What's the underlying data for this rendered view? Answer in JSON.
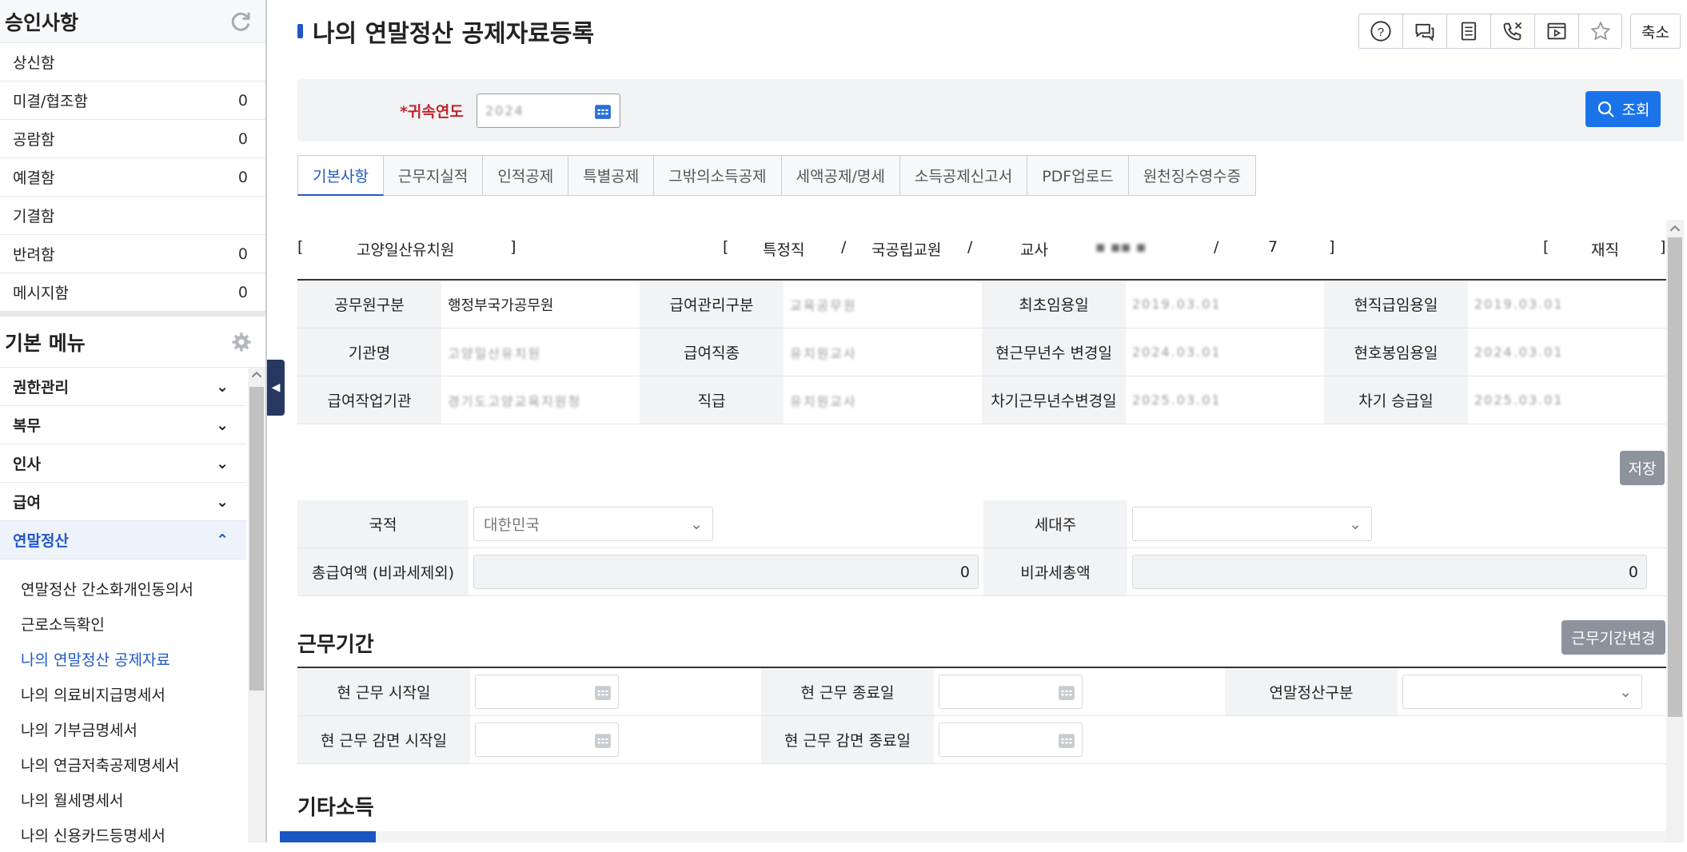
{
  "sidebar": {
    "approval_title": "승인사항",
    "approval_items": [
      {
        "label": "상신함",
        "count": ""
      },
      {
        "label": "미결/협조함",
        "count": "0"
      },
      {
        "label": "공람함",
        "count": "0"
      },
      {
        "label": "예결함",
        "count": "0"
      },
      {
        "label": "기결함",
        "count": ""
      },
      {
        "label": "반려함",
        "count": "0"
      },
      {
        "label": "메시지함",
        "count": "0"
      }
    ],
    "menu_title": "기본 메뉴",
    "menu_items": [
      {
        "label": "권한관리"
      },
      {
        "label": "복무"
      },
      {
        "label": "인사"
      },
      {
        "label": "급여"
      },
      {
        "label": "연말정산"
      }
    ],
    "sub_items": [
      {
        "label": "연말정산 간소화개인동의서"
      },
      {
        "label": "근로소득확인"
      },
      {
        "label": "나의 연말정산 공제자료"
      },
      {
        "label": "나의 의료비지급명세서"
      },
      {
        "label": "나의 기부금명세서"
      },
      {
        "label": "나의 연금저축공제명세서"
      },
      {
        "label": "나의 월세명세서"
      },
      {
        "label": "나의 신용카드등명세서"
      }
    ]
  },
  "header": {
    "title": "나의 연말정산 공제자료등록",
    "toolbar_icons": [
      "help-icon",
      "chat-icon",
      "document-icon",
      "phone-icon",
      "video-icon",
      "star-icon"
    ],
    "shrink_label": "축소"
  },
  "search": {
    "year_label": "*귀속연도",
    "year_value": "2024",
    "button_label": "조회"
  },
  "tabs": [
    "기본사항",
    "근무지실적",
    "인적공제",
    "특별공제",
    "그밖의소득공제",
    "세액공제/명세",
    "소득공제신고서",
    "PDF업로드",
    "원천징수영수증"
  ],
  "info": {
    "school": "고양일산유치원",
    "job_type": "특정직",
    "category": "국공립교원",
    "position": "교사",
    "grade": "7",
    "status": "재직"
  },
  "detail": {
    "row1": [
      {
        "h": "공무원구분",
        "v": "행정부국가공무원"
      },
      {
        "h": "급여관리구분",
        "v": "교육공무원"
      },
      {
        "h": "최초임용일",
        "v": "2019.03.01"
      },
      {
        "h": "현직급임용일",
        "v": "2019.03.01"
      }
    ],
    "row2": [
      {
        "h": "기관명",
        "v": "고양일산유치원"
      },
      {
        "h": "급여직종",
        "v": "유치원교사"
      },
      {
        "h": "현근무년수 변경일",
        "v": "2024.03.01"
      },
      {
        "h": "현호봉임용일",
        "v": "2024.03.01"
      }
    ],
    "row3": [
      {
        "h": "급여작업기관",
        "v": "경기도고양교육지원청"
      },
      {
        "h": "직급",
        "v": "유치원교사"
      },
      {
        "h": "차기근무년수변경일",
        "v": "2025.03.01"
      },
      {
        "h": "차기 승급일",
        "v": "2025.03.01"
      }
    ]
  },
  "save_label": "저장",
  "form2": {
    "nationality_label": "국적",
    "nationality_value": "대한민국",
    "householder_label": "세대주",
    "householder_value": "",
    "total_pay_label": "총급여액 (비과세제외)",
    "total_pay_value": "0",
    "nontax_label": "비과세총액",
    "nontax_value": "0"
  },
  "period": {
    "section_title": "근무기간",
    "change_button": "근무기간변경",
    "start_label": "현 근무 시작일",
    "end_label": "현 근무 종료일",
    "settle_label": "연말정산구분",
    "reduce_start_label": "현 근무 감면 시작일",
    "reduce_end_label": "현 근무 감면 종료일"
  },
  "other_income_title": "기타소득",
  "colors": {
    "accent": "#1f57c3",
    "primary_btn": "#1a73e8",
    "required": "#c0262d"
  }
}
